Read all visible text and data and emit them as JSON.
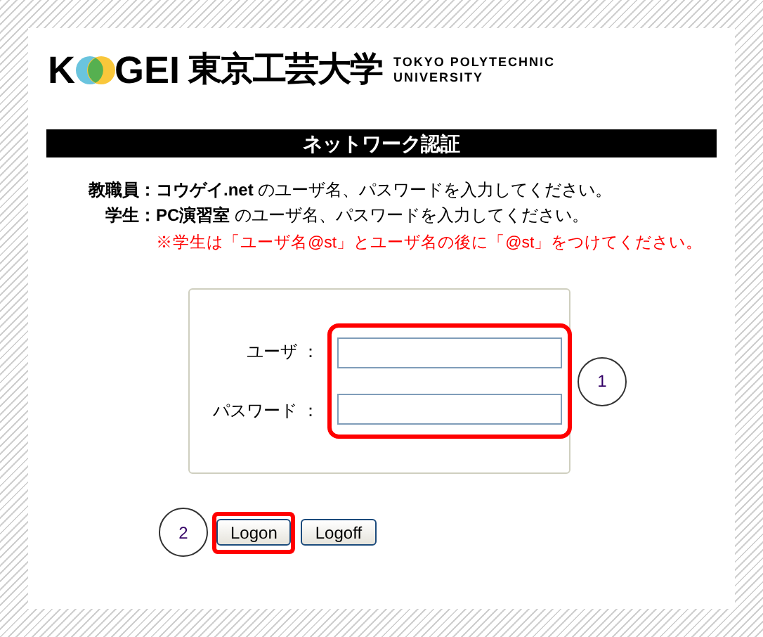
{
  "logo": {
    "prefix": "K",
    "suffix": "GEI",
    "name_ja": "東京工芸大学",
    "name_en": [
      "TOKYO POLYTECHNIC",
      "UNIVERSITY"
    ]
  },
  "title": "ネットワーク認証",
  "instructions": [
    {
      "label": "教職員：",
      "text": "**コウゲイ.net** のユーザ名、パスワードを入力してください。"
    },
    {
      "label": "学生：",
      "text": "**PC演習室** のユーザ名、パスワードを入力してください。"
    }
  ],
  "note": "※学生は「ユーザ名@st」とユーザ名の後に「@st」をつけてください。",
  "fields": [
    {
      "label": "ユーザ ："
    },
    {
      "label": "パスワード ："
    }
  ],
  "fields_callout": "1",
  "buttons_callout": "2",
  "buttons": [
    {
      "label": "Logon",
      "highlighted": true
    },
    {
      "label": "Logoff",
      "highlighted": false
    }
  ]
}
